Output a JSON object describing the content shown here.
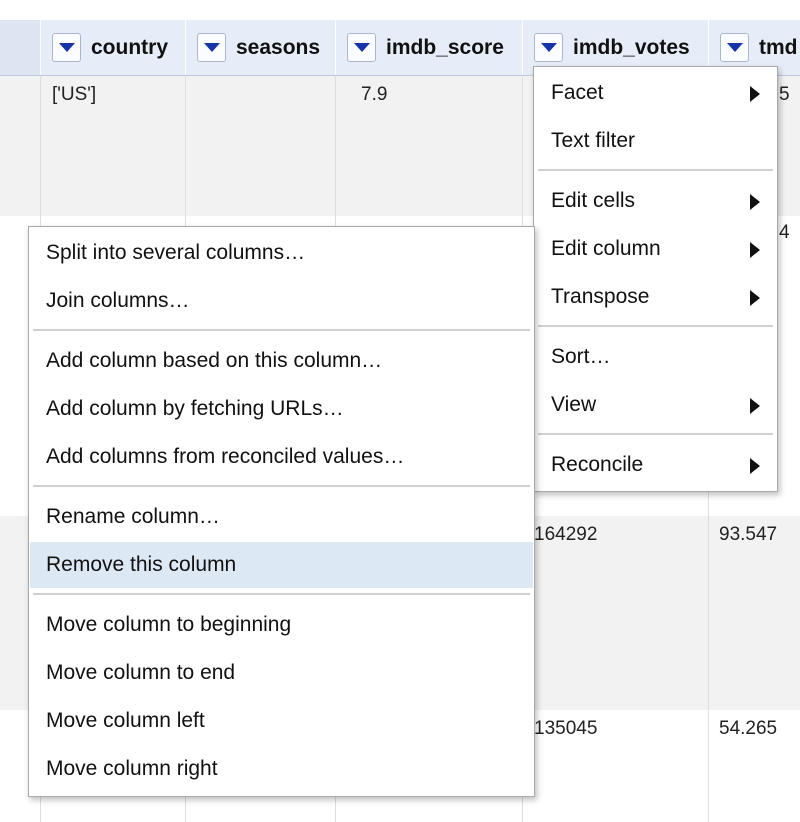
{
  "columns": [
    {
      "name": "country"
    },
    {
      "name": "seasons"
    },
    {
      "name": "imdb_score"
    },
    {
      "name": "imdb_votes"
    },
    {
      "name": "tmd"
    }
  ],
  "rows": [
    {
      "country": "['US']",
      "imdb_score": "7.9",
      "tmdb_tail": "5"
    },
    {
      "tmdb_tail": "4"
    },
    {
      "imdb_votes": "164292",
      "tmdb": "93.547"
    },
    {
      "imdb_votes": "135045",
      "tmdb": "54.265"
    }
  ],
  "column_menu": {
    "items": [
      {
        "label": "Facet",
        "submenu": true
      },
      {
        "label": "Text filter",
        "submenu": false
      },
      {
        "label": "Edit cells",
        "submenu": true
      },
      {
        "label": "Edit column",
        "submenu": true
      },
      {
        "label": "Transpose",
        "submenu": true
      },
      {
        "label": "Sort…",
        "submenu": false
      },
      {
        "label": "View",
        "submenu": true
      },
      {
        "label": "Reconcile",
        "submenu": true
      }
    ]
  },
  "edit_column_submenu": {
    "items": [
      {
        "label": "Split into several columns…"
      },
      {
        "label": "Join columns…"
      },
      {
        "label": "Add column based on this column…"
      },
      {
        "label": "Add column by fetching URLs…"
      },
      {
        "label": "Add columns from reconciled values…"
      },
      {
        "label": "Rename column…"
      },
      {
        "label": "Remove this column",
        "highlighted": true
      },
      {
        "label": "Move column to beginning"
      },
      {
        "label": "Move column to end"
      },
      {
        "label": "Move column left"
      },
      {
        "label": "Move column right"
      }
    ]
  },
  "colors": {
    "header_bg": "#e6edf8",
    "dropdown_arrow": "#1633a8",
    "highlight": "#dde8f5"
  }
}
